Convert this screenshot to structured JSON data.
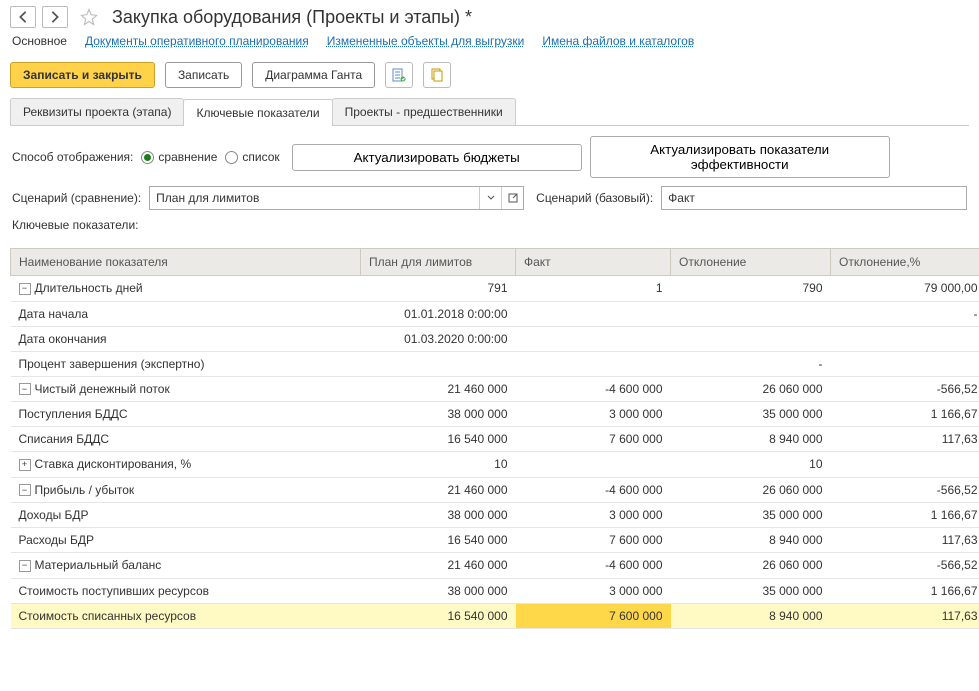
{
  "header": {
    "title": "Закупка оборудования (Проекты и этапы) *"
  },
  "sections": {
    "active": "Основное",
    "links": [
      "Документы оперативного планирования",
      "Измененные объекты для выгрузки",
      "Имена файлов и каталогов"
    ]
  },
  "toolbar": {
    "save_close": "Записать и закрыть",
    "save": "Записать",
    "gantt": "Диаграмма Ганта"
  },
  "tabs": [
    "Реквизиты проекта (этапа)",
    "Ключевые показатели",
    "Проекты - предшественники"
  ],
  "active_tab_index": 1,
  "display_mode": {
    "label": "Способ отображения:",
    "compare": "сравнение",
    "list": "список",
    "selected": "compare"
  },
  "buttons": {
    "refresh_budgets": "Актуализировать бюджеты",
    "refresh_eff": "Актуализировать показатели эффективности"
  },
  "scenario": {
    "cmp_label": "Сценарий (сравнение):",
    "cmp_value": "План для лимитов",
    "base_label": "Сценарий (базовый):",
    "base_value": "Факт"
  },
  "table_title": "Ключевые показатели:",
  "columns": {
    "name": "Наименование показателя",
    "plan": "План для лимитов",
    "fact": "Факт",
    "dev": "Отклонение",
    "pct": "Отклонение,%"
  },
  "rows": [
    {
      "exp": "-",
      "lvl": 0,
      "name": "Длительность дней",
      "plan": "791",
      "fact": "1",
      "dev": "790",
      "pct": "79 000,00"
    },
    {
      "exp": "",
      "lvl": 1,
      "name": "Дата начала",
      "plan": "01.01.2018 0:00:00",
      "fact": "",
      "dev": "",
      "pct": "-"
    },
    {
      "exp": "",
      "lvl": 1,
      "name": "Дата окончания",
      "plan": "01.03.2020 0:00:00",
      "fact": "",
      "dev": "",
      "pct": ""
    },
    {
      "exp": "",
      "lvl": 1,
      "name": "Процент завершения (экспертно)",
      "plan": "",
      "fact": "",
      "dev": "-",
      "pct": ""
    },
    {
      "exp": "-",
      "lvl": 0,
      "name": "Чистый денежный поток",
      "plan": "21 460 000",
      "fact": "-4 600 000",
      "dev": "26 060 000",
      "pct": "-566,52"
    },
    {
      "exp": "",
      "lvl": 1,
      "name": "Поступления БДДС",
      "plan": "38 000 000",
      "fact": "3 000 000",
      "dev": "35 000 000",
      "pct": "1 166,67"
    },
    {
      "exp": "",
      "lvl": 1,
      "name": "Списания БДДС",
      "plan": "16 540 000",
      "fact": "7 600 000",
      "dev": "8 940 000",
      "pct": "117,63"
    },
    {
      "exp": "+",
      "lvl": 0,
      "name": "Ставка дисконтирования, %",
      "plan": "10",
      "fact": "",
      "dev": "10",
      "pct": ""
    },
    {
      "exp": "-",
      "lvl": 0,
      "name": "Прибыль / убыток",
      "plan": "21 460 000",
      "fact": "-4 600 000",
      "dev": "26 060 000",
      "pct": "-566,52"
    },
    {
      "exp": "",
      "lvl": 1,
      "name": "Доходы БДР",
      "plan": "38 000 000",
      "fact": "3 000 000",
      "dev": "35 000 000",
      "pct": "1 166,67"
    },
    {
      "exp": "",
      "lvl": 1,
      "name": "Расходы БДР",
      "plan": "16 540 000",
      "fact": "7 600 000",
      "dev": "8 940 000",
      "pct": "117,63"
    },
    {
      "exp": "-",
      "lvl": 0,
      "name": "Материальный баланс",
      "plan": "21 460 000",
      "fact": "-4 600 000",
      "dev": "26 060 000",
      "pct": "-566,52"
    },
    {
      "exp": "",
      "lvl": 1,
      "name": "Стоимость поступивших ресурсов",
      "plan": "38 000 000",
      "fact": "3 000 000",
      "dev": "35 000 000",
      "pct": "1 166,67"
    },
    {
      "exp": "",
      "lvl": 1,
      "name": "Стоимость списанных ресурсов",
      "plan": "16 540 000",
      "fact": "7 600 000",
      "dev": "8 940 000",
      "pct": "117,63",
      "sel": true
    }
  ]
}
